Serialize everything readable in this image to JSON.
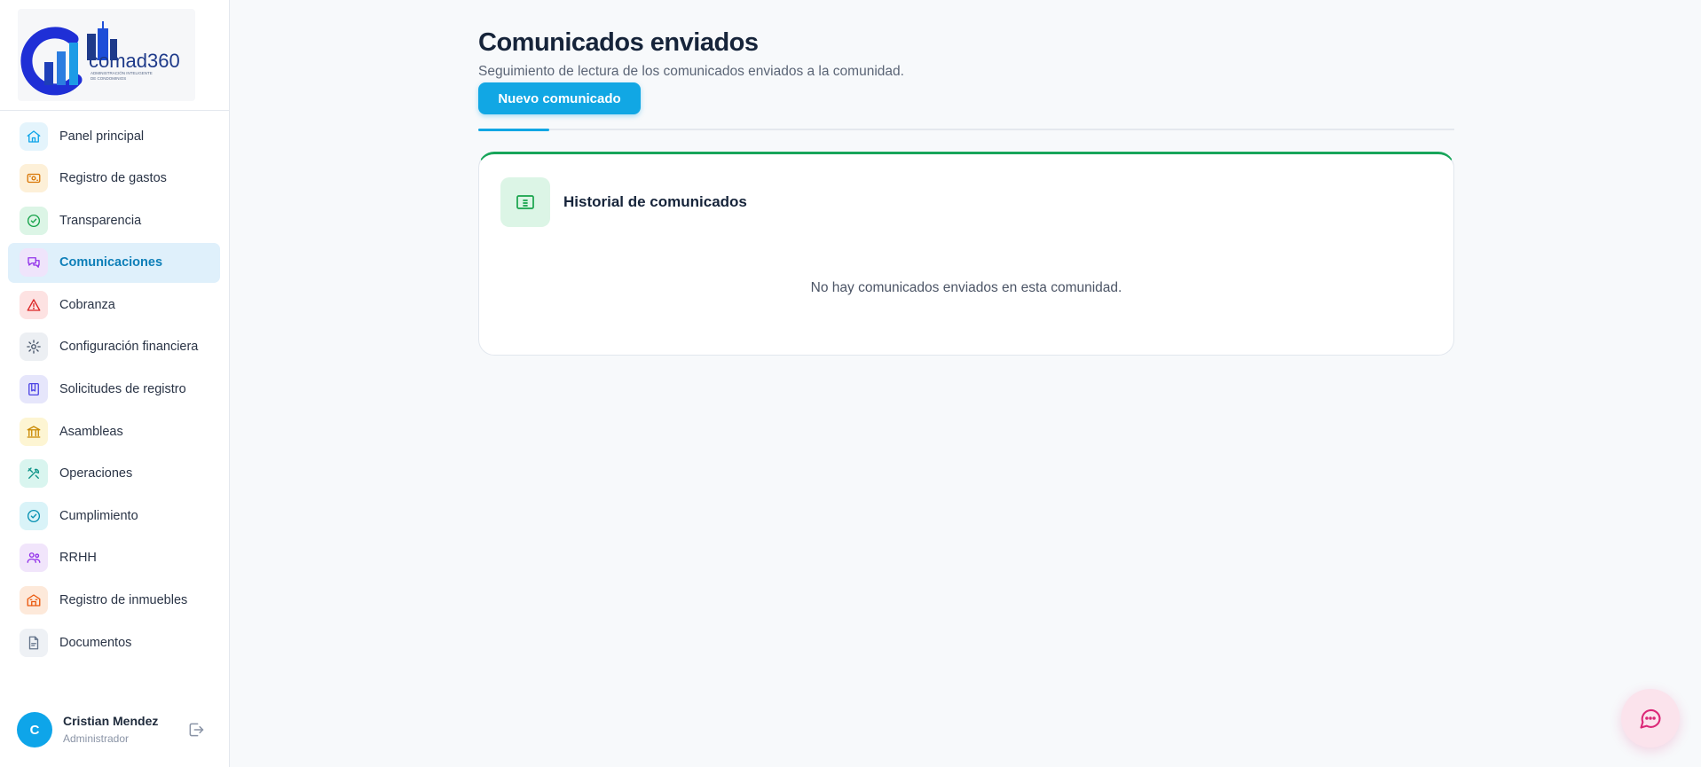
{
  "brand": {
    "logo_text": "comad360",
    "logo_tagline_1": "ADMINISTRACIÓN INTELIGENTE",
    "logo_tagline_2": "DE CONDOMINIOS"
  },
  "sidebar": {
    "items": [
      {
        "label": "Panel principal",
        "icon": "home-icon",
        "color": "#0ea5e9",
        "bg": "#e4f4fc",
        "active": false
      },
      {
        "label": "Registro de gastos",
        "icon": "banknote-icon",
        "color": "#d97706",
        "bg": "#fdf0d8",
        "active": false
      },
      {
        "label": "Transparencia",
        "icon": "check-circle-icon",
        "color": "#16a34a",
        "bg": "#dcf5e6",
        "active": false
      },
      {
        "label": "Comunicaciones",
        "icon": "chat-bubbles-icon",
        "color": "#9333ea",
        "bg": "#efe4fb",
        "active": true
      },
      {
        "label": "Cobranza",
        "icon": "warning-triangle-icon",
        "color": "#dc2626",
        "bg": "#fde2e2",
        "active": false
      },
      {
        "label": "Configuración financiera",
        "icon": "gear-icon",
        "color": "#475569",
        "bg": "#eceff3",
        "active": false
      },
      {
        "label": "Solicitudes de registro",
        "icon": "book-icon",
        "color": "#4f46e5",
        "bg": "#e6e6fb",
        "active": false
      },
      {
        "label": "Asambleas",
        "icon": "landmark-icon",
        "color": "#ca8a04",
        "bg": "#fdf5d3",
        "active": false
      },
      {
        "label": "Operaciones",
        "icon": "tools-icon",
        "color": "#0d9488",
        "bg": "#d9f5ef",
        "active": false
      },
      {
        "label": "Cumplimiento",
        "icon": "check-circle-icon",
        "color": "#0891b2",
        "bg": "#d9f3f8",
        "active": false
      },
      {
        "label": "RRHH",
        "icon": "people-icon",
        "color": "#9333ea",
        "bg": "#f1e5fb",
        "active": false
      },
      {
        "label": "Registro de inmuebles",
        "icon": "building-icon",
        "color": "#ea580c",
        "bg": "#fde9da",
        "active": false
      },
      {
        "label": "Documentos",
        "icon": "document-icon",
        "color": "#64748b",
        "bg": "#eef1f5",
        "active": false
      }
    ]
  },
  "user": {
    "initial": "C",
    "name": "Cristian Mendez",
    "role": "Administrador"
  },
  "main": {
    "title": "Comunicados enviados",
    "subtitle": "Seguimiento de lectura de los comunicados enviados a la comunidad.",
    "new_button": "Nuevo comunicado",
    "card": {
      "title": "Historial de comunicados",
      "empty_message": "No hay comunicados enviados en esta comunidad."
    }
  },
  "colors": {
    "accent": "#11a7e4",
    "card_top_border": "#18a55a",
    "chat_fab": "#db2777"
  }
}
